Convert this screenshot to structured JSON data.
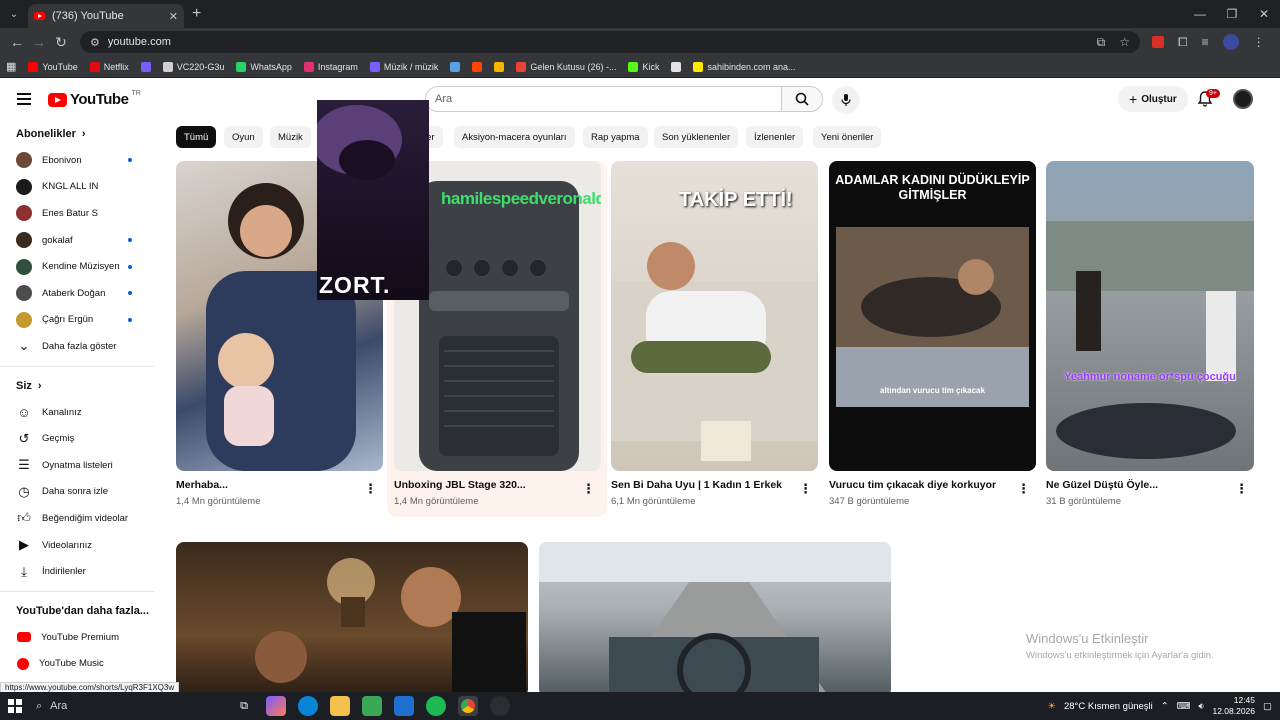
{
  "browser": {
    "tab_title": "(736) YouTube",
    "url": "youtube.com",
    "bookmarks": [
      {
        "label": "YouTube",
        "color": "#ff0000"
      },
      {
        "label": "Netflix",
        "color": "#e50914"
      },
      {
        "label": "",
        "color": "#7b5cff"
      },
      {
        "label": "VC220-G3u",
        "color": "#cfcfcf"
      },
      {
        "label": "WhatsApp",
        "color": "#25d366"
      },
      {
        "label": "Instagram",
        "color": "#e1306c"
      },
      {
        "label": "Müzik / müzik",
        "color": "#7b5cff"
      },
      {
        "label": "",
        "color": "#5aa0e6"
      },
      {
        "label": "",
        "color": "#ff4500"
      },
      {
        "label": "",
        "color": "#f5b400"
      },
      {
        "label": "Gelen Kutusu (26) -...",
        "color": "#ea4335"
      },
      {
        "label": "Kick",
        "color": "#53fc18"
      },
      {
        "label": "",
        "color": "#e3e3e3"
      },
      {
        "label": "sahibinden.com ana...",
        "color": "#ffe800"
      }
    ]
  },
  "youtube": {
    "logo_text": "YouTube",
    "logo_region": "TR",
    "search_placeholder": "Ara",
    "create_label": "Oluştur",
    "notification_count": "9+",
    "sidebar": {
      "subscriptions_title": "Abonelikler",
      "subscriptions": [
        {
          "name": "Ebonivon",
          "dot": true,
          "color": "#6b4a3a"
        },
        {
          "name": "KNGL ALL IN",
          "dot": false,
          "color": "#1a1a1a"
        },
        {
          "name": "Enes Batur S",
          "dot": false,
          "color": "#8b2f2f"
        },
        {
          "name": "gokalaf",
          "dot": true,
          "color": "#3b2a1e"
        },
        {
          "name": "Kendine Müzisyen",
          "dot": true,
          "color": "#2f4f3a"
        },
        {
          "name": "Ataberk Doğan",
          "dot": true,
          "color": "#4b4b4b"
        },
        {
          "name": "Çağrı Ergün",
          "dot": true,
          "color": "#c49a2c"
        }
      ],
      "show_more": "Daha fazla göster",
      "you_title": "Siz",
      "you_items": [
        {
          "label": "Kanalınız",
          "icon": "user-icon"
        },
        {
          "label": "Geçmiş",
          "icon": "history-icon"
        },
        {
          "label": "Oynatma listeleri",
          "icon": "playlist-icon"
        },
        {
          "label": "Daha sonra izle",
          "icon": "clock-icon"
        },
        {
          "label": "Beğendiğim videolar",
          "icon": "thumbs-up-icon"
        },
        {
          "label": "Videolarınız",
          "icon": "video-icon"
        },
        {
          "label": "İndirilenler",
          "icon": "download-icon"
        }
      ],
      "more_title": "YouTube'dan daha fazla...",
      "more_items": [
        "YouTube Premium",
        "YouTube Music"
      ]
    },
    "chips": [
      "Tümü",
      "Oyun",
      "Müzik",
      "ler",
      "Aksiyon-macera oyunları",
      "Rap yapma",
      "Son yüklenenler",
      "İzlenenler",
      "Yeni öneriler"
    ],
    "shorts": [
      {
        "title": "Merhaba...",
        "views": "1,4 Mn görüntüleme",
        "overlay": ""
      },
      {
        "title": "Unboxing JBL Stage 320...",
        "views": "1,4 Mn görüntüleme",
        "overlay": "hamilespeedveronaldo TAKİP ETTİ!"
      },
      {
        "title": "Sen Bi Daha Uyu | 1 Kadın 1 Erkek",
        "views": "6,1 Mn görüntüleme",
        "overlay": ""
      },
      {
        "title": "Vurucu tim çıkacak diye korkuyor",
        "views": "347 B görüntüleme",
        "overlay": "ADAMLAR KADINI DÜDÜKLEYİP GİTMİŞLER",
        "caption": "altından vurucu tim çıkacak"
      },
      {
        "title": "Ne Güzel Düştü Öyle...",
        "views": "31 B görüntüleme",
        "overlay": "Yeahmur noname or*spu çocuğu"
      }
    ],
    "zort_overlay": "ZORT.",
    "watermark": {
      "line1": "Windows'u Etkinleştir",
      "line2": "Windows'u etkinleştirmek için Ayarlar'a gidin."
    },
    "status_url": "https://www.youtube.com/shorts/LyqR3F1XQ3w"
  },
  "taskbar": {
    "search_placeholder": "Ara",
    "weather": "28°C  Kısmen güneşli",
    "time": "12:45",
    "date": "12.08.2026"
  }
}
